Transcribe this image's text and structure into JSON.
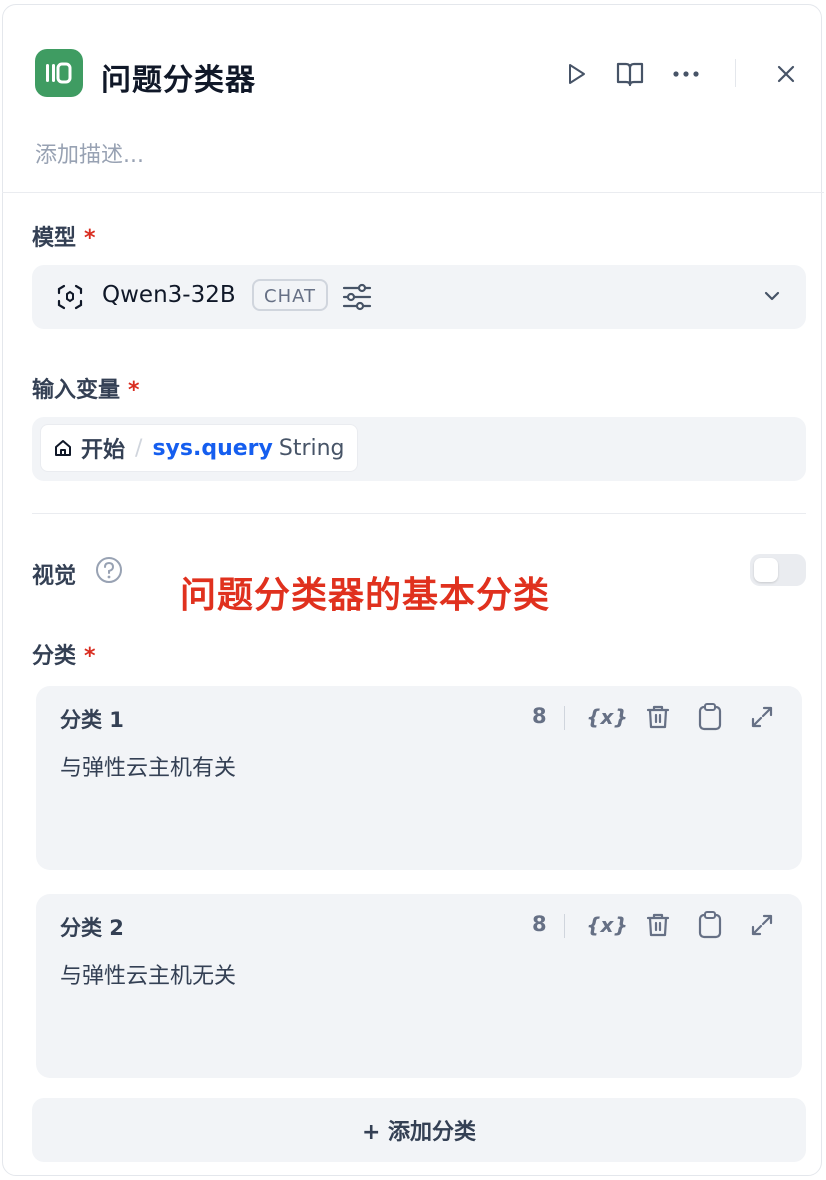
{
  "header": {
    "title": "问题分类器",
    "description_placeholder": "添加描述..."
  },
  "model": {
    "label": "模型",
    "required_mark": "*",
    "name": "Qwen3-32B",
    "mode_badge": "CHAT"
  },
  "input_variable": {
    "label": "输入变量",
    "required_mark": "*",
    "node": "开始",
    "separator": "/",
    "variable": "sys.query",
    "type": "String"
  },
  "vision": {
    "label": "视觉",
    "enabled": false
  },
  "annotation": "问题分类器的基本分类",
  "classes": {
    "label": "分类",
    "required_mark": "*",
    "items": [
      {
        "title": "分类 1",
        "text": "与弹性云主机有关",
        "count": "8"
      },
      {
        "title": "分类 2",
        "text": "与弹性云主机无关",
        "count": "8"
      }
    ],
    "add_label": "+ 添加分类"
  },
  "colors": {
    "accent": "#3f9c62",
    "link": "#155eef",
    "required": "#d92d20",
    "annotation": "#e0311e"
  }
}
